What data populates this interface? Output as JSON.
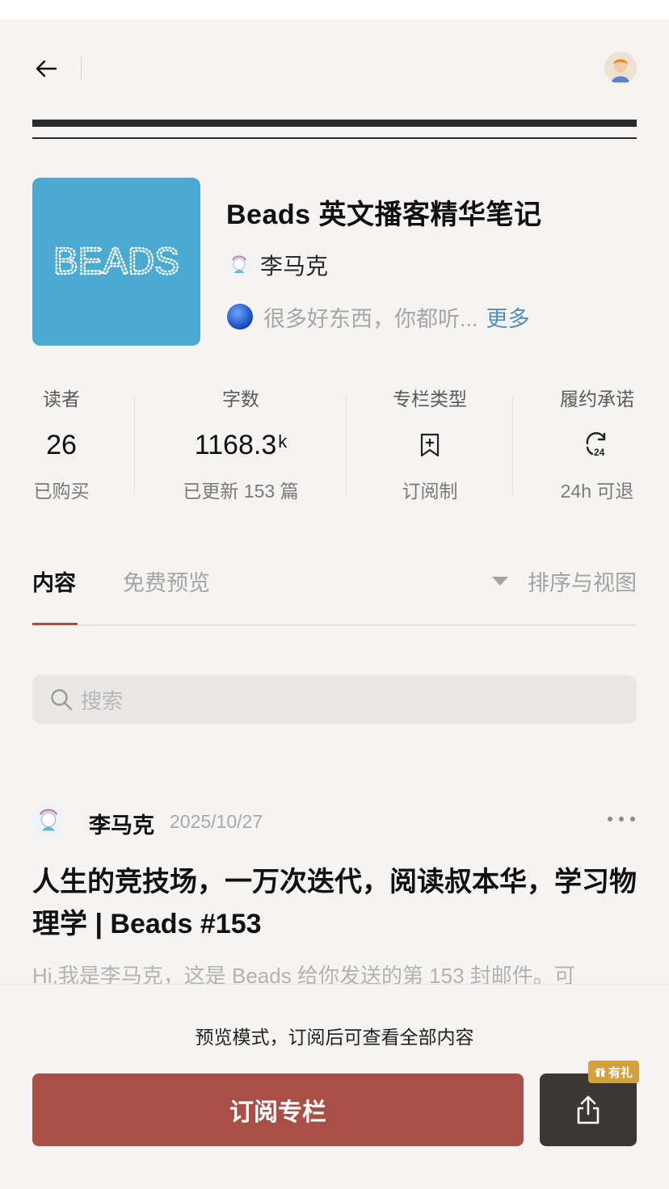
{
  "header": {
    "back_icon": "arrow-left-icon",
    "user_avatar": "user-avatar"
  },
  "column": {
    "cover_text": "BEADS",
    "cover_color": "#4aaad2",
    "title": "Beads 英文播客精华笔记",
    "author": "李马克",
    "description": "很多好东西，你都听...",
    "more_label": "更多"
  },
  "stats": [
    {
      "label": "读者",
      "value": "26",
      "unit": "",
      "sub": "已购买"
    },
    {
      "label": "字数",
      "value": "1168.3",
      "unit": "k",
      "sub": "已更新 153 篇"
    },
    {
      "label": "专栏类型",
      "icon": "bookmark-plus-icon",
      "sub": "订阅制"
    },
    {
      "label": "履约承诺",
      "icon": "refund-24h-icon",
      "sub": "24h 可退"
    }
  ],
  "tabs": {
    "content": "内容",
    "free_preview": "免费预览",
    "sort_view": "排序与视图"
  },
  "search": {
    "placeholder": "搜索"
  },
  "post": {
    "author": "李马克",
    "date": "2025/10/27",
    "title": "人生的竞技场，一万次迭代，阅读叔本华，学习物理学 | Beads #153",
    "excerpt": "Hi,我是李马克，这是 Beads 给你发送的第 153 封邮件。可"
  },
  "bottom": {
    "preview_note": "预览模式，订阅后可查看全部内容",
    "subscribe_label": "订阅专栏",
    "gift_badge": "有礼"
  },
  "colors": {
    "accent": "#a85048",
    "tab_underline": "#b04a40",
    "link": "#4f8fb9",
    "badge": "#d4a23c"
  }
}
